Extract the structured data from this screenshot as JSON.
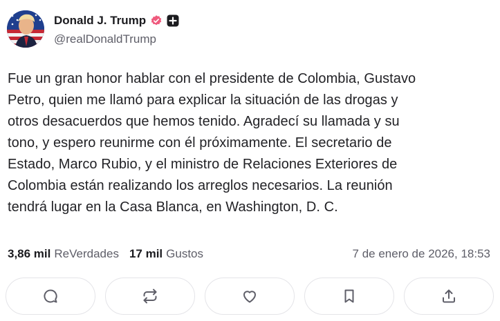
{
  "author": {
    "display_name": "Donald J. Trump",
    "handle": "@realDonaldTrump",
    "avatar_icon": "flag-portrait-avatar",
    "verified_icon": "verified-badge-icon",
    "verified_color": "#ef5a7d",
    "plus_icon": "plus-badge-icon"
  },
  "post": {
    "text": "Fue un gran honor hablar con el presidente de Colombia, Gustavo\nPetro, quien me llamó para explicar la situación de las drogas y\notros desacuerdos que hemos tenido. Agradecí su llamada y su\ntono, y espero reunirme con él próximamente. El secretario de\nEstado, Marco Rubio, y el ministro de Relaciones Exteriores de\nColombia están realizando los arreglos necesarios. La reunión\ntendrá lugar en la Casa Blanca, en Washington, D. C."
  },
  "stats": {
    "retruths_count": "3,86 mil",
    "retruths_label": "ReVerdades",
    "likes_count": "17 mil",
    "likes_label": "Gustos",
    "timestamp": "7 de enero de 2026, 18:53"
  },
  "actions": [
    {
      "icon": "reply-icon"
    },
    {
      "icon": "retruth-icon"
    },
    {
      "icon": "like-icon"
    },
    {
      "icon": "bookmark-icon"
    },
    {
      "icon": "share-icon"
    }
  ],
  "colors": {
    "text": "#222226",
    "muted": "#5e5e68",
    "border": "#e4e4e8"
  }
}
